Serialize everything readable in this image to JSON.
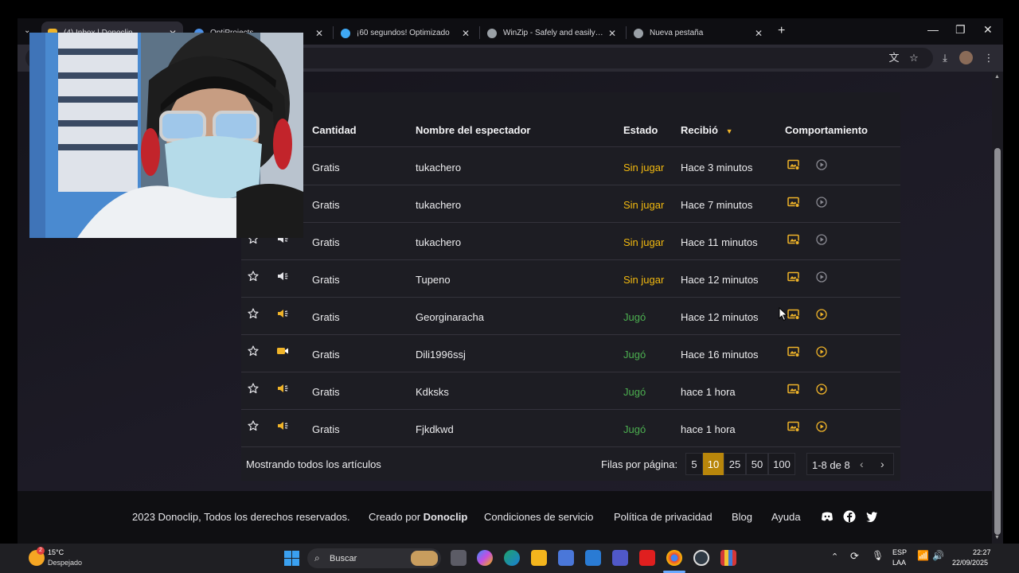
{
  "browser": {
    "tabs": [
      {
        "label": "(4) Inbox | Donoclip",
        "active": true
      },
      {
        "label": "OptiProjects",
        "active": false
      },
      {
        "label": "¡60 segundos! Optimizado",
        "active": false
      },
      {
        "label": "WinZip - Safely and easily open",
        "active": false
      },
      {
        "label": "Nueva pestaña",
        "active": false
      }
    ],
    "new_tab": "+",
    "window_controls": {
      "minimize": "—",
      "restore": "❐",
      "close": "✕"
    }
  },
  "table": {
    "headers": {
      "amount": "Cantidad",
      "viewer": "Nombre del espectador",
      "status": "Estado",
      "received": "Recibió",
      "behavior": "Comportamiento"
    },
    "rows": [
      {
        "amount": "Gratis",
        "viewer": "tukachero",
        "status": "Sin jugar",
        "received": "Hace 3 minutos",
        "type": "audio"
      },
      {
        "amount": "Gratis",
        "viewer": "tukachero",
        "status": "Sin jugar",
        "received": "Hace 7 minutos",
        "type": "audio"
      },
      {
        "amount": "Gratis",
        "viewer": "tukachero",
        "status": "Sin jugar",
        "received": "Hace 11 minutos",
        "type": "audio"
      },
      {
        "amount": "Gratis",
        "viewer": "Tupeno",
        "status": "Sin jugar",
        "received": "Hace 12 minutos",
        "type": "audio"
      },
      {
        "amount": "Gratis",
        "viewer": "Georginaracha",
        "status": "Jugó",
        "received": "Hace 12 minutos",
        "type": "audio"
      },
      {
        "amount": "Gratis",
        "viewer": "Dili1996ssj",
        "status": "Jugó",
        "received": "Hace 16 minutos",
        "type": "video"
      },
      {
        "amount": "Gratis",
        "viewer": "Kdksks",
        "status": "Jugó",
        "received": "hace 1 hora",
        "type": "audio"
      },
      {
        "amount": "Gratis",
        "viewer": "Fjkdkwd",
        "status": "Jugó",
        "received": "hace 1 hora",
        "type": "audio"
      }
    ]
  },
  "pagination": {
    "showing": "Mostrando todos los artículos",
    "rows_per_page_label": "Filas por página:",
    "options": [
      "5",
      "10",
      "25",
      "50",
      "100"
    ],
    "selected": "10",
    "range": "1-8 de 8"
  },
  "footer": {
    "copyright": "2023 Donoclip, Todos los derechos reservados.",
    "created_by_prefix": "Creado por ",
    "created_by_brand": "Donoclip",
    "terms": "Condiciones de servicio",
    "privacy": "Política de privacidad",
    "blog": "Blog",
    "help": "Ayuda"
  },
  "taskbar": {
    "weather_temp": "15°C",
    "weather_desc": "Despejado",
    "weather_badge": "2",
    "search_label": "Buscar",
    "lang_top": "ESP",
    "lang_bottom": "LAA",
    "time": "22:27",
    "date": "22/09/2025"
  },
  "colors": {
    "status_unplayed": "#f2b90f",
    "status_played": "#4caf50",
    "accent": "#b8860b",
    "icon_accent": "#f0b429"
  }
}
